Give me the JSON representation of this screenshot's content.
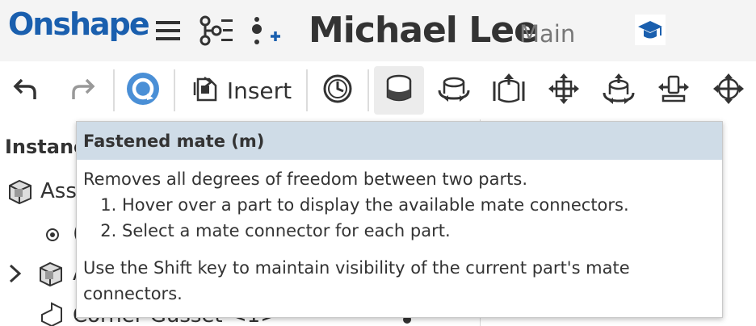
{
  "header": {
    "logo": "Onshape",
    "document_title": "Michael Lee",
    "branch": "Main",
    "icons": [
      "menu-icon",
      "feature-list-icon",
      "add-variable-icon",
      "learning-center-icon"
    ]
  },
  "toolbar": {
    "insert_label": "Insert",
    "icons": [
      "undo-icon",
      "redo-icon",
      "refresh-icon",
      "insert-icon",
      "history-icon",
      "fastened-mate-icon",
      "revolute-mate-icon",
      "slider-mate-icon",
      "planar-mate-icon",
      "cylindrical-mate-icon",
      "pin-slot-mate-icon",
      "ball-mate-icon"
    ]
  },
  "panel": {
    "title": "Instanc",
    "rows": [
      {
        "label": "Ass"
      },
      {
        "label": "("
      },
      {
        "label": "A"
      },
      {
        "label": "Corner Gusset <1>"
      }
    ]
  },
  "tooltip": {
    "title": "Fastened mate (m)",
    "description": "Removes all degrees of freedom between two parts.",
    "steps": [
      "Hover over a part to display the available mate connectors.",
      "Select a mate connector for each part."
    ],
    "note": "Use the Shift key to maintain visibility of the current part's mate connectors."
  },
  "colors": {
    "brand": "#1a5fae",
    "tooltip_header": "#cfdce7",
    "refresh_blue": "#4a8fd6"
  }
}
